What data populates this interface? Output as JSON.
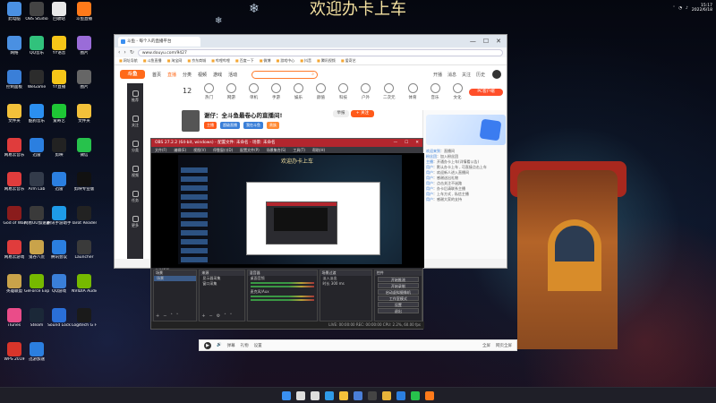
{
  "banner_title": "欢迎办卡上车",
  "desktop_icons": [
    {
      "label": "此电脑",
      "color": "#4a90e2"
    },
    {
      "label": "OBS Studio",
      "color": "#444444"
    },
    {
      "label": "回收站",
      "color": "#e8e8e8"
    },
    {
      "label": "斗鱼直播",
      "color": "#ff7a1a"
    },
    {
      "label": "网络",
      "color": "#4a90e2"
    },
    {
      "label": "QQ音乐",
      "color": "#31c27c"
    },
    {
      "label": "YY语音",
      "color": "#f5c518"
    },
    {
      "label": "图片",
      "color": "#9a6cd8"
    },
    {
      "label": "控制面板",
      "color": "#3a7fd8"
    },
    {
      "label": "WeGame",
      "color": "#2c2c2c"
    },
    {
      "label": "YY直播",
      "color": "#f5c518"
    },
    {
      "label": "图片",
      "color": "#666666"
    },
    {
      "label": "文件夹",
      "color": "#f3c13a"
    },
    {
      "label": "酷狗音乐",
      "color": "#2b8ff0"
    },
    {
      "label": "爱奇艺",
      "color": "#1ec735"
    },
    {
      "label": "文件夹",
      "color": "#f3c13a"
    },
    {
      "label": "网易云音乐",
      "color": "#e03c3c"
    },
    {
      "label": "迅雷",
      "color": "#2b7fe0"
    },
    {
      "label": "剪映",
      "color": "#222222"
    },
    {
      "label": "微信",
      "color": "#27c24c"
    },
    {
      "label": "网易云音乐",
      "color": "#e03c3c"
    },
    {
      "label": "Arm Lab",
      "color": "#333b4a"
    },
    {
      "label": "迅雷",
      "color": "#2b7fe0"
    },
    {
      "label": "剪映专业版",
      "color": "#111111"
    },
    {
      "label": "God of War",
      "color": "#8a1c1c"
    },
    {
      "label": "网易UU加速器",
      "color": "#3a3a3a"
    },
    {
      "label": "腾讯手游助手",
      "color": "#1e9be8"
    },
    {
      "label": "Tarot Reader",
      "color": "#222222"
    },
    {
      "label": "网易云游戏",
      "color": "#e03c3c"
    },
    {
      "label": "鬼谷八荒",
      "color": "#c9a34a"
    },
    {
      "label": "腾讯会议",
      "color": "#2b7fe0"
    },
    {
      "label": "Launcher",
      "color": "#3a3a3a"
    },
    {
      "label": "英雄联盟",
      "color": "#c9a34a"
    },
    {
      "label": "GeForce Experience",
      "color": "#76b900"
    },
    {
      "label": "QQ游戏",
      "color": "#3a7fd8"
    },
    {
      "label": "NVIDIA Audio",
      "color": "#76b900"
    },
    {
      "label": "iTunes",
      "color": "#ea4c89"
    },
    {
      "label": "Steam",
      "color": "#1b2838"
    },
    {
      "label": "Sound Lock",
      "color": "#2a6fd8"
    },
    {
      "label": "Logitech G HUB",
      "color": "#1a1a1a"
    },
    {
      "label": "WPS 2019",
      "color": "#d8352a"
    },
    {
      "label": "迅游加速",
      "color": "#2b7fe0"
    }
  ],
  "browser": {
    "tab_title": "斗鱼 - 每个人的直播平台",
    "url_host": "www.douyu.com",
    "url_path": "/9427",
    "bookmarks": [
      "网址导航",
      "斗鱼直播",
      "淘宝网",
      "京东商城",
      "哔哩哔哩",
      "百度一下",
      "微博",
      "游戏中心",
      "抖音",
      "腾讯视频",
      "爱奇艺"
    ],
    "win_controls": [
      "—",
      "☐",
      "✕"
    ]
  },
  "douyu": {
    "logo": "斗鱼",
    "nav": [
      "首页",
      "直播",
      "分类",
      "视频",
      "游戏",
      "活动"
    ],
    "nav_active_index": 1,
    "search_icon": "search-icon",
    "header_right": [
      "开播",
      "消息",
      "关注",
      "历史"
    ],
    "date_num": "12",
    "categories": [
      "热门",
      "网游",
      "单机",
      "手游",
      "娱乐",
      "颜值",
      "科技",
      "户外",
      "二次元",
      "体育",
      "音乐",
      "文化"
    ],
    "pc_badge": "PC客户端",
    "rail": [
      "推荐",
      "关注",
      "分类",
      "视频",
      "任务",
      "更多"
    ],
    "room_title": "谢仔：全斗鱼最卷心的直播间!",
    "room_tags": [
      {
        "text": "主播",
        "color": "#ff5a1a"
      },
      {
        "text": "超级直播",
        "color": "#3a7fd8"
      },
      {
        "text": "我在斗鱼",
        "color": "#3a7fd8"
      },
      {
        "text": "贵族",
        "color": "#ff8a33"
      }
    ],
    "report_label": "举报",
    "follow_label": "+ 关注",
    "chat": [
      {
        "user": "欢迎来到",
        "text": "直播间"
      },
      {
        "user": "粉丝团",
        "text": "加入粉丝团"
      },
      {
        "user": "主播",
        "text": "开通办卡上车(详情看公告)"
      },
      {
        "user": "用户",
        "text": "默认办卡上车 , 可直接点击上车"
      },
      {
        "user": "用户",
        "text": "欢迎新人进入直播间"
      },
      {
        "user": "用户",
        "text": "感谢送出礼物"
      },
      {
        "user": "用户",
        "text": "点击关注不迷路"
      },
      {
        "user": "用户",
        "text": "办卡后请联系主播"
      },
      {
        "user": "用户",
        "text": "上车方式 , 私信主播"
      },
      {
        "user": "用户",
        "text": "感谢大家的支持"
      }
    ]
  },
  "obs": {
    "title": "OBS 27.2.2 (64-bit, windows) - 配置文件: 未命名 - 场景: 未命名",
    "menu": [
      "文件(F)",
      "编辑(E)",
      "视图(V)",
      "停靠窗口(D)",
      "配置文件(P)",
      "场景集合(S)",
      "工具(T)",
      "帮助(H)"
    ],
    "nested_title": "欢迎办卡上车",
    "source_bar": "未选择源",
    "docks": {
      "scenes": {
        "title": "场景",
        "items": [
          "场景"
        ]
      },
      "sources": {
        "title": "来源",
        "items": [
          "显示器采集",
          "窗口采集"
        ]
      },
      "mixer": {
        "title": "混音器",
        "items": [
          "桌面音频",
          "麦克风/Aux"
        ]
      },
      "transitions": {
        "title": "场景过渡",
        "items": [
          "淡入淡出",
          "时长 300 ms"
        ]
      },
      "controls": {
        "title": "控件",
        "buttons": [
          "开始推流",
          "开始录制",
          "启动虚拟摄像机",
          "工作室模式",
          "设置",
          "退出"
        ]
      }
    },
    "status": "LIVE: 00:00:00  REC: 00:00:00  CPU: 2.2%, 60.00 fps"
  },
  "bottom_bar": {
    "items": [
      "弹幕",
      "礼物",
      "设置"
    ],
    "right": [
      "全屏",
      "网页全屏"
    ]
  },
  "taskbar": {
    "icons": [
      "windows-start",
      "search",
      "task-view",
      "edge",
      "explorer",
      "store",
      "obs",
      "chrome",
      "qq",
      "wechat",
      "douyu"
    ],
    "time": "15:17",
    "date": "2022/6/18"
  }
}
